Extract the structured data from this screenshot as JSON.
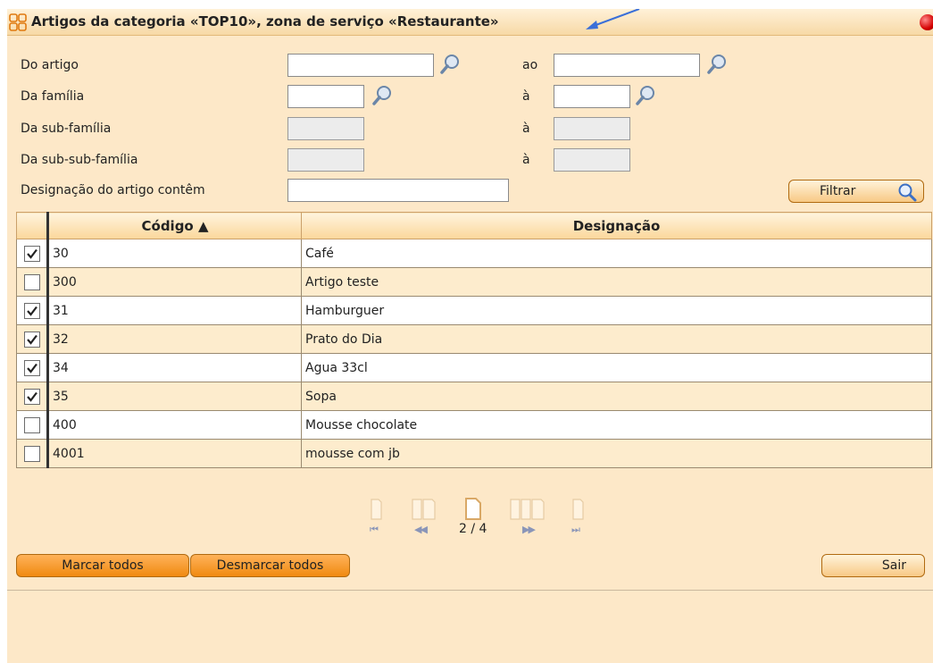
{
  "window": {
    "title": "Artigos da categoria «TOP10», zona de serviço «Restaurante»"
  },
  "filters": {
    "do_artigo": {
      "label": "Do artigo",
      "to_label": "ao",
      "from_value": "",
      "to_value": ""
    },
    "da_familia": {
      "label": "Da família",
      "to_label": "à",
      "from_value": "",
      "to_value": ""
    },
    "da_sub_familia": {
      "label": "Da sub-família",
      "to_label": "à",
      "from_value": "",
      "to_value": ""
    },
    "da_sub_sub_familia": {
      "label": "Da sub-sub-família",
      "to_label": "à",
      "from_value": "",
      "to_value": ""
    },
    "designacao": {
      "label": "Designação do artigo contêm",
      "value": ""
    },
    "filter_button": "Filtrar"
  },
  "table": {
    "columns": [
      "",
      "Código ▲",
      "Designação"
    ],
    "rows": [
      {
        "checked": true,
        "code": "30",
        "name": "Café"
      },
      {
        "checked": false,
        "code": "300",
        "name": "Artigo teste"
      },
      {
        "checked": true,
        "code": "31",
        "name": "Hamburguer"
      },
      {
        "checked": true,
        "code": "32",
        "name": "Prato do Dia"
      },
      {
        "checked": true,
        "code": "34",
        "name": "Agua 33cl"
      },
      {
        "checked": true,
        "code": "35",
        "name": "Sopa"
      },
      {
        "checked": false,
        "code": "400",
        "name": "Mousse chocolate"
      },
      {
        "checked": false,
        "code": "4001",
        "name": "mousse com jb"
      }
    ]
  },
  "pager": {
    "indicator": "2 / 4",
    "first": "⏮",
    "prev": "◀◀",
    "next": "▶▶",
    "last": "⏭"
  },
  "actions": {
    "select_all": "Marcar todos",
    "deselect_all": "Desmarcar todos",
    "exit": "Sair"
  },
  "colors": {
    "panel_bg": "#fde8c8",
    "header_gradient_end": "#fbd79b",
    "row_even": "#fdeccd",
    "button_dark": "#f08a10",
    "close_dot": "#d40000"
  }
}
